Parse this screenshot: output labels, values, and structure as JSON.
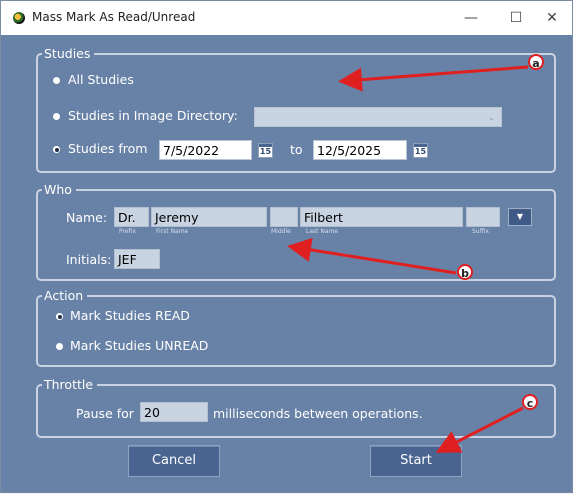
{
  "window": {
    "title": "Mass Mark As Read/Unread",
    "minimize_icon": "minimize-icon",
    "maximize_icon": "maximize-icon",
    "close_icon": "close-icon"
  },
  "studies": {
    "legend": "Studies",
    "all_label": "All Studies",
    "image_dir_label": "Studies in Image Directory:",
    "image_dir_value": "",
    "from_label": "Studies from",
    "from_date": "7/5/2022",
    "to_label": "to",
    "to_date": "12/5/2025",
    "calendar_day": "15",
    "selected": "from"
  },
  "who": {
    "legend": "Who",
    "name_label": "Name:",
    "prefix": "Dr.",
    "first": "Jeremy",
    "middle": "",
    "last": "Filbert",
    "suffix": "",
    "prefix_caption": "Prefix",
    "first_caption": "First Name",
    "middle_caption": "Middle",
    "last_caption": "Last Name",
    "suffix_caption": "Suffix",
    "initials_label": "Initials:",
    "initials": "JEF"
  },
  "action": {
    "legend": "Action",
    "read_label": "Mark Studies READ",
    "unread_label": "Mark Studies UNREAD",
    "selected": "read"
  },
  "throttle": {
    "legend": "Throttle",
    "pause_label": "Pause for",
    "pause_value": "20",
    "suffix_label": "milliseconds between operations."
  },
  "buttons": {
    "cancel": "Cancel",
    "start": "Start"
  },
  "annotations": {
    "a": "a",
    "b": "b",
    "c": "c",
    "color": "#e02020"
  }
}
